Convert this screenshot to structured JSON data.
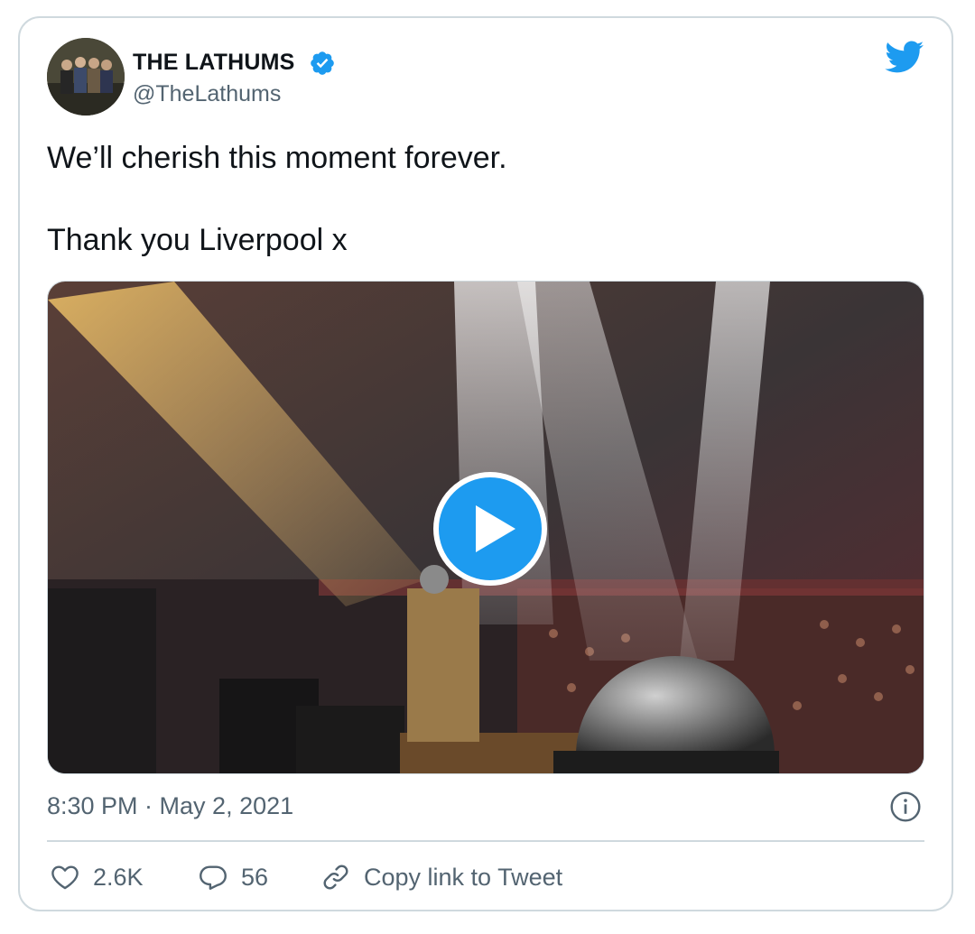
{
  "author": {
    "display_name": "THE LATHUMS",
    "handle": "@TheLathums",
    "verified": true
  },
  "tweet": {
    "line1": "We’ll cherish this moment forever.",
    "line2": "Thank you Liverpool x"
  },
  "media": {
    "type": "video"
  },
  "meta": {
    "timestamp": "8:30 PM · May 2, 2021"
  },
  "actions": {
    "likes": "2.6K",
    "replies": "56",
    "copy_link": "Copy link to Tweet"
  },
  "colors": {
    "accent": "#1d9bf0",
    "muted_text": "#536471",
    "border": "#cfd9de"
  },
  "icons": [
    "avatar-image",
    "verified-badge-icon",
    "twitter-bird-icon",
    "play-icon",
    "info-icon",
    "heart-icon",
    "reply-icon",
    "link-icon"
  ]
}
